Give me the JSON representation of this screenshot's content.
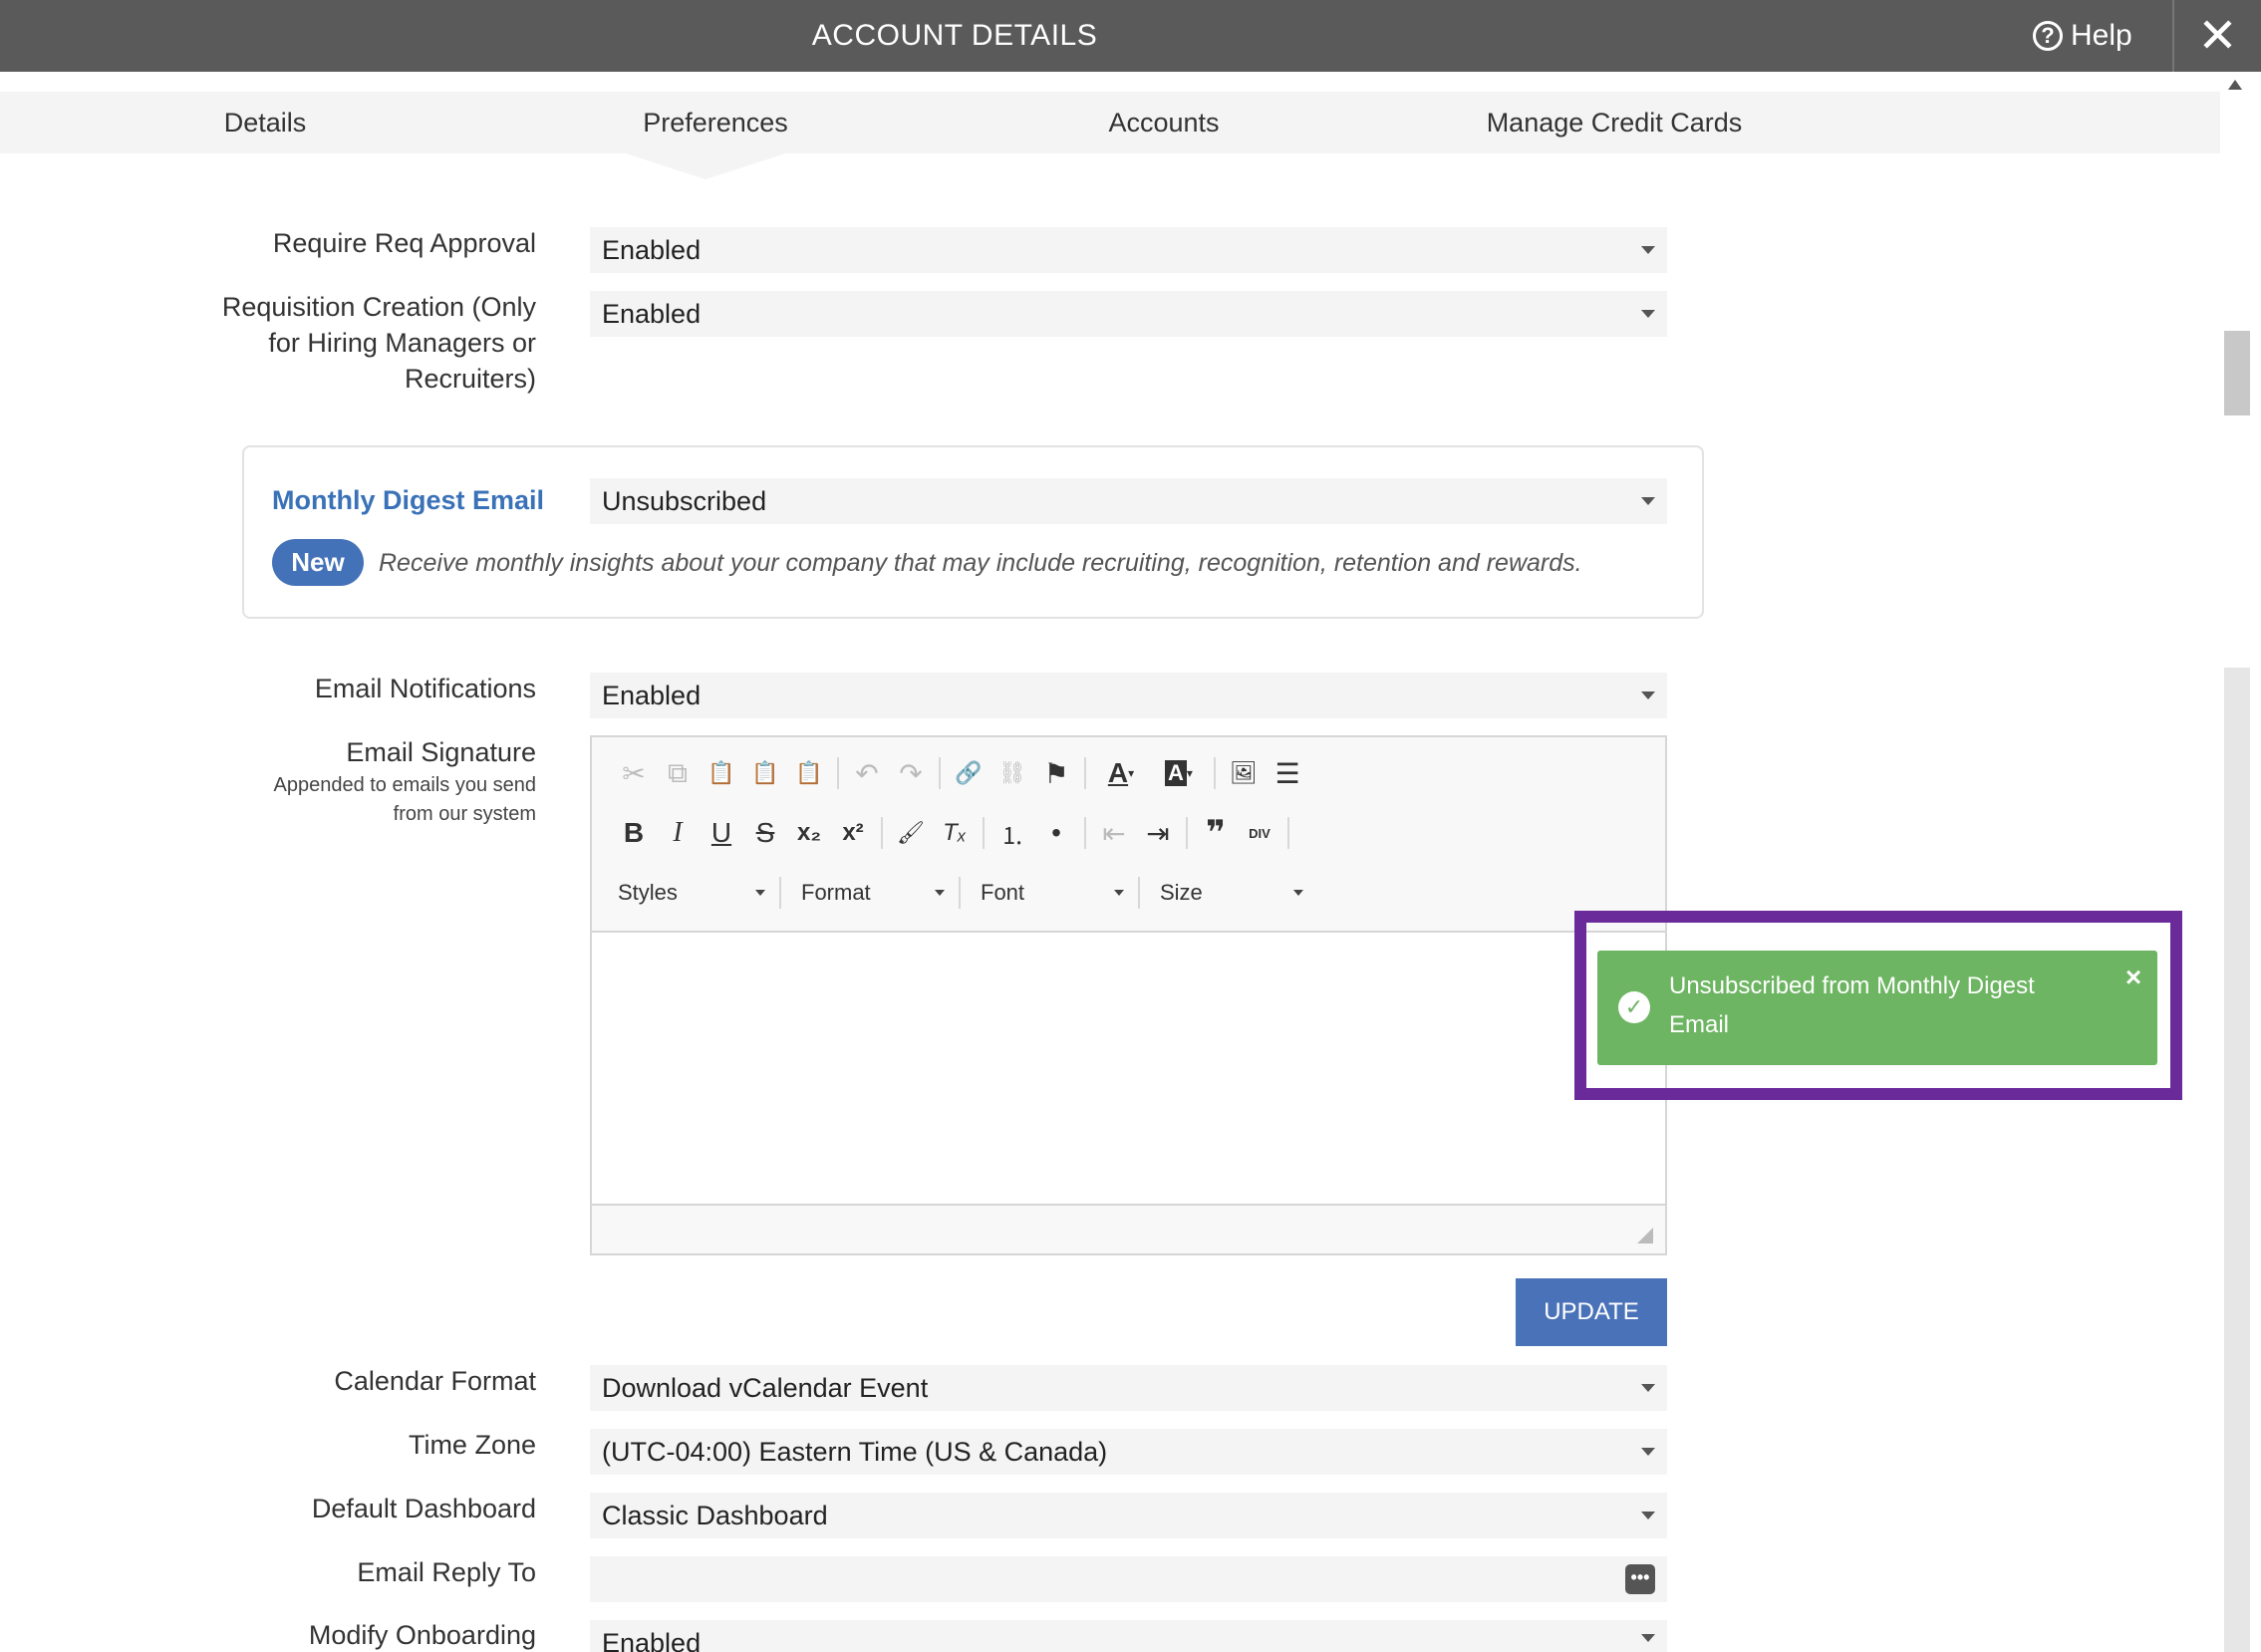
{
  "header": {
    "title": "ACCOUNT DETAILS",
    "help_label": "Help",
    "help_icon": "?"
  },
  "tabs": [
    {
      "label": "Details"
    },
    {
      "label": "Preferences"
    },
    {
      "label": "Accounts"
    },
    {
      "label": "Manage Credit Cards"
    }
  ],
  "active_tab": "Preferences",
  "fields": {
    "require_req_approval": {
      "label": "Require Req Approval",
      "value": "Enabled"
    },
    "requisition_creation": {
      "label_lines": [
        "Requisition Creation (Only",
        "for Hiring Managers or",
        "Recruiters)"
      ],
      "value": "Enabled"
    },
    "monthly_digest": {
      "label": "Monthly Digest Email",
      "value": "Unsubscribed",
      "badge": "New",
      "description": "Receive monthly insights about your company that may include recruiting, recognition, retention and rewards."
    },
    "email_notifications": {
      "label": "Email Notifications",
      "value": "Enabled"
    },
    "email_signature": {
      "label": "Email Signature",
      "sublabel_lines": [
        "Appended to emails you send",
        "from our system"
      ]
    },
    "calendar_format": {
      "label": "Calendar Format",
      "value": "Download vCalendar Event"
    },
    "time_zone": {
      "label": "Time Zone",
      "value": "(UTC-04:00) Eastern Time (US & Canada)"
    },
    "default_dashboard": {
      "label": "Default Dashboard",
      "value": "Classic Dashboard"
    },
    "email_reply_to": {
      "label": "Email Reply To",
      "value": "",
      "button_glyph": "•••"
    },
    "modify_onboarding": {
      "label": "Modify Onboarding",
      "value": "Enabled"
    }
  },
  "editor": {
    "combos": [
      "Styles",
      "Format",
      "Font",
      "Size"
    ],
    "toolbar_row1": [
      {
        "icon": "cut-icon",
        "glyph": "✂",
        "enabled": false
      },
      {
        "icon": "copy-icon",
        "glyph": "⧉",
        "enabled": false
      },
      {
        "icon": "paste-icon",
        "glyph": "📋",
        "enabled": true
      },
      {
        "icon": "paste-text-icon",
        "glyph": "📋",
        "enabled": true
      },
      {
        "icon": "paste-word-icon",
        "glyph": "📋",
        "enabled": true
      },
      {
        "icon": "undo-icon",
        "glyph": "↶",
        "enabled": false
      },
      {
        "icon": "redo-icon",
        "glyph": "↷",
        "enabled": false
      },
      {
        "icon": "link-icon",
        "glyph": "🔗",
        "enabled": true
      },
      {
        "icon": "unlink-icon",
        "glyph": "⛓",
        "enabled": false
      },
      {
        "icon": "anchor-flag-icon",
        "glyph": "⚑",
        "enabled": true
      },
      {
        "icon": "text-color-icon",
        "glyph": "A",
        "enabled": true
      },
      {
        "icon": "background-color-icon",
        "glyph": "A",
        "enabled": true
      },
      {
        "icon": "image-icon",
        "glyph": "🖼",
        "enabled": true
      },
      {
        "icon": "horizontal-line-icon",
        "glyph": "☰",
        "enabled": true
      }
    ],
    "toolbar_row2": [
      {
        "icon": "bold-icon",
        "glyph": "B",
        "enabled": true
      },
      {
        "icon": "italic-icon",
        "glyph": "I",
        "enabled": true
      },
      {
        "icon": "underline-icon",
        "glyph": "U",
        "enabled": true
      },
      {
        "icon": "strikethrough-icon",
        "glyph": "S",
        "enabled": true
      },
      {
        "icon": "subscript-icon",
        "glyph": "x₂",
        "enabled": true
      },
      {
        "icon": "superscript-icon",
        "glyph": "x²",
        "enabled": true
      },
      {
        "icon": "copy-format-icon",
        "glyph": "🖌",
        "enabled": true
      },
      {
        "icon": "remove-format-icon",
        "glyph": "Tₓ",
        "enabled": true
      },
      {
        "icon": "numbered-list-icon",
        "glyph": "⒈",
        "enabled": true
      },
      {
        "icon": "bulleted-list-icon",
        "glyph": "•",
        "enabled": true
      },
      {
        "icon": "outdent-icon",
        "glyph": "⇤",
        "enabled": false
      },
      {
        "icon": "indent-icon",
        "glyph": "⇥",
        "enabled": true
      },
      {
        "icon": "blockquote-icon",
        "glyph": "❞",
        "enabled": true
      },
      {
        "icon": "create-div-icon",
        "glyph": "DIV",
        "enabled": true
      }
    ]
  },
  "update_button": "UPDATE",
  "toast": {
    "message": "Unsubscribed from Monthly Digest Email",
    "check_glyph": "✓",
    "close_glyph": "×"
  },
  "colors": {
    "header_bg": "#5a5a5a",
    "accent_blue": "#4472b8",
    "toast_green": "#6db562",
    "highlight_purple": "#6a2a9a"
  }
}
